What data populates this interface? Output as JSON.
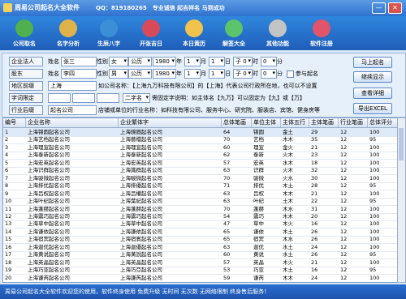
{
  "window": {
    "app_title": "周易公司起名大全软件",
    "header_text": "QQ：819180265　专业诚信 起吉祥名 马到成功",
    "min_symbol": "—",
    "close_symbol": "✕"
  },
  "toolbar": [
    {
      "label": "公司取名",
      "icon": "house-icon",
      "color": "#4fb04f"
    },
    {
      "label": "名字分析",
      "icon": "ribbon-icon",
      "color": "#e0b24a"
    },
    {
      "label": "生辰八字",
      "icon": "globe-icon",
      "color": "#3a8fd6"
    },
    {
      "label": "开张吉日",
      "icon": "calendar-icon",
      "color": "#d84a5a"
    },
    {
      "label": "本日黄历",
      "icon": "almanac-icon",
      "color": "#f0c34d"
    },
    {
      "label": "解签大全",
      "icon": "star-icon",
      "color": "#5ec46b"
    },
    {
      "label": "其他功能",
      "icon": "tools-icon",
      "color": "#c4c4c4"
    },
    {
      "label": "软件注册",
      "icon": "lock-icon",
      "color": "#e0556a"
    }
  ],
  "form": {
    "row1": {
      "label": "企业法人",
      "name_label": "姓名",
      "name": "张三",
      "sex_label": "性别",
      "sex": "女",
      "cal": "公历",
      "year": "1980",
      "year_unit": "年",
      "month": "1",
      "month_unit": "月",
      "day": "1",
      "day_unit": "日",
      "hour": "子 0",
      "hour_unit": "时",
      "min": "0",
      "min_unit": "分"
    },
    "row2": {
      "label": "股东",
      "name_label": "姓名",
      "name": "李四",
      "sex_label": "性别",
      "sex": "男",
      "cal": "公历",
      "year": "1980",
      "year_unit": "年",
      "month": "1",
      "month_unit": "月",
      "day": "1",
      "day_unit": "日",
      "hour": "子 0",
      "hour_unit": "时",
      "min": "0",
      "min_unit": "分",
      "join_label": "参与起名"
    },
    "region_label": "地区前缀",
    "region_value": "上海",
    "region_hint": "如公司名称：【上海九万科技有限公司】的【上海】代表公司行政所在地，也可以不设置",
    "fixed_label": "字词限定",
    "fixed_select": "二字名",
    "fixed_hint": "需固定字说明：如主体名【九万】可以固定为【九】或【万】",
    "industry_label": "行业后缀",
    "industry_value": "起名公司",
    "industry_hint": "店铺或单位的行业名称：如科技有限公司、服务中心、研究院、服装店、宾馆、健身房等"
  },
  "buttons": {
    "start": "马上起名",
    "continue": "继续显示",
    "detail": "查看详细",
    "export": "导出EXCEL"
  },
  "table": {
    "headers": [
      "编号",
      "企业名称",
      "企业繁体字",
      "总体笔画",
      "单位主体",
      "主体五行",
      "主体笔画",
      "行业笔画",
      "总体评分"
    ],
    "rows": [
      [
        "1",
        "上海锦圆起名公司",
        "上海錦圓起名公司",
        "64",
        "锦圆",
        "金土",
        "29",
        "12",
        "100"
      ],
      [
        "2",
        "上海艺档起名公司",
        "上海藝檔起名公司",
        "70",
        "艺档",
        "木木",
        "35",
        "12",
        "95"
      ],
      [
        "3",
        "上海理宣起名公司",
        "上海理宣起名公司",
        "60",
        "理宣",
        "金火",
        "21",
        "12",
        "100"
      ],
      [
        "4",
        "上海泰新起名公司",
        "上海泰新起名公司",
        "62",
        "泰新",
        "火木",
        "23",
        "12",
        "100"
      ],
      [
        "5",
        "上海宏英起名公司",
        "上海宏英起名公司",
        "57",
        "宏英",
        "水木",
        "18",
        "12",
        "100"
      ],
      [
        "6",
        "上海识群起名公司",
        "上海識群起名公司",
        "63",
        "识群",
        "火木",
        "32",
        "12",
        "100"
      ],
      [
        "7",
        "上海骏微起名公司",
        "上海駿微起名公司",
        "70",
        "骏微",
        "火水",
        "30",
        "12",
        "100"
      ],
      [
        "8",
        "上海排优起名公司",
        "上海排優起名公司",
        "71",
        "排优",
        "木土",
        "28",
        "12",
        "95"
      ],
      [
        "9",
        "上海吕权起名公司",
        "上海吕權起名公司",
        "63",
        "吕权",
        "木木",
        "21",
        "12",
        "100"
      ],
      [
        "10",
        "上海叶纪起名公司",
        "上海葉紀起名公司",
        "63",
        "叶纪",
        "土木",
        "22",
        "12",
        "95"
      ],
      [
        "11",
        "上海蓬赫起名公司",
        "上海蓬赫起名公司",
        "70",
        "蓬赫",
        "木水",
        "31",
        "12",
        "100"
      ],
      [
        "12",
        "上海震巧起名公司",
        "上海震巧起名公司",
        "54",
        "震巧",
        "木木",
        "20",
        "12",
        "100"
      ],
      [
        "13",
        "上海草中起名公司",
        "上海草中起名公司",
        "47",
        "草中",
        "木火",
        "16",
        "12",
        "100"
      ],
      [
        "14",
        "上海谦依起名公司",
        "上海謙依起名公司",
        "65",
        "谦依",
        "木土",
        "26",
        "12",
        "100"
      ],
      [
        "15",
        "上海宿宾起名公司",
        "上海宿賓起名公司",
        "65",
        "宿宾",
        "木水",
        "26",
        "12",
        "100"
      ],
      [
        "16",
        "上海迦优起名公司",
        "上海迦優起名公司",
        "63",
        "迦优",
        "水土",
        "24",
        "12",
        "100"
      ],
      [
        "17",
        "上海黄说起名公司",
        "上海黃說起名公司",
        "60",
        "黄说",
        "水土",
        "26",
        "12",
        "95"
      ],
      [
        "18",
        "上海英晶起名公司",
        "上海英晶起名公司",
        "57",
        "英晶",
        "木火",
        "21",
        "12",
        "100"
      ],
      [
        "19",
        "上海巧亚起名公司",
        "上海巧亞起名公司",
        "53",
        "巧亚",
        "木土",
        "16",
        "12",
        "95"
      ],
      [
        "20",
        "上海谦芮起名公司",
        "上海謙芮起名公司",
        "59",
        "谦芮",
        "木木",
        "24",
        "12",
        "100"
      ]
    ]
  },
  "status": "周易公司起名大全软件欢迎您的使用，软件终身使用 免费升级 无时间 无次数 无网络限制 终身售后服务！"
}
